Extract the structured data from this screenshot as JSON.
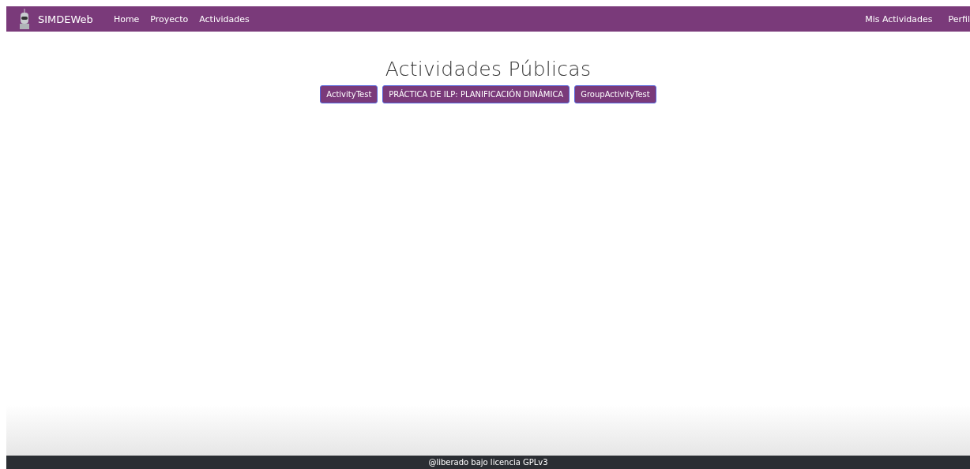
{
  "navbar": {
    "brand": "SIMDEWeb",
    "links": [
      "Home",
      "Proyecto",
      "Actividades"
    ],
    "right_links": [
      "Mis Actividades",
      "Perfil"
    ]
  },
  "heading": "Actividades Públicas",
  "activities": [
    "ActivityTest",
    "PRÁCTICA DE ILP: PLANIFICACIÓN DINÁMICA",
    "GroupActivityTest"
  ],
  "footer": "@liberado bajo licencia GPLv3"
}
